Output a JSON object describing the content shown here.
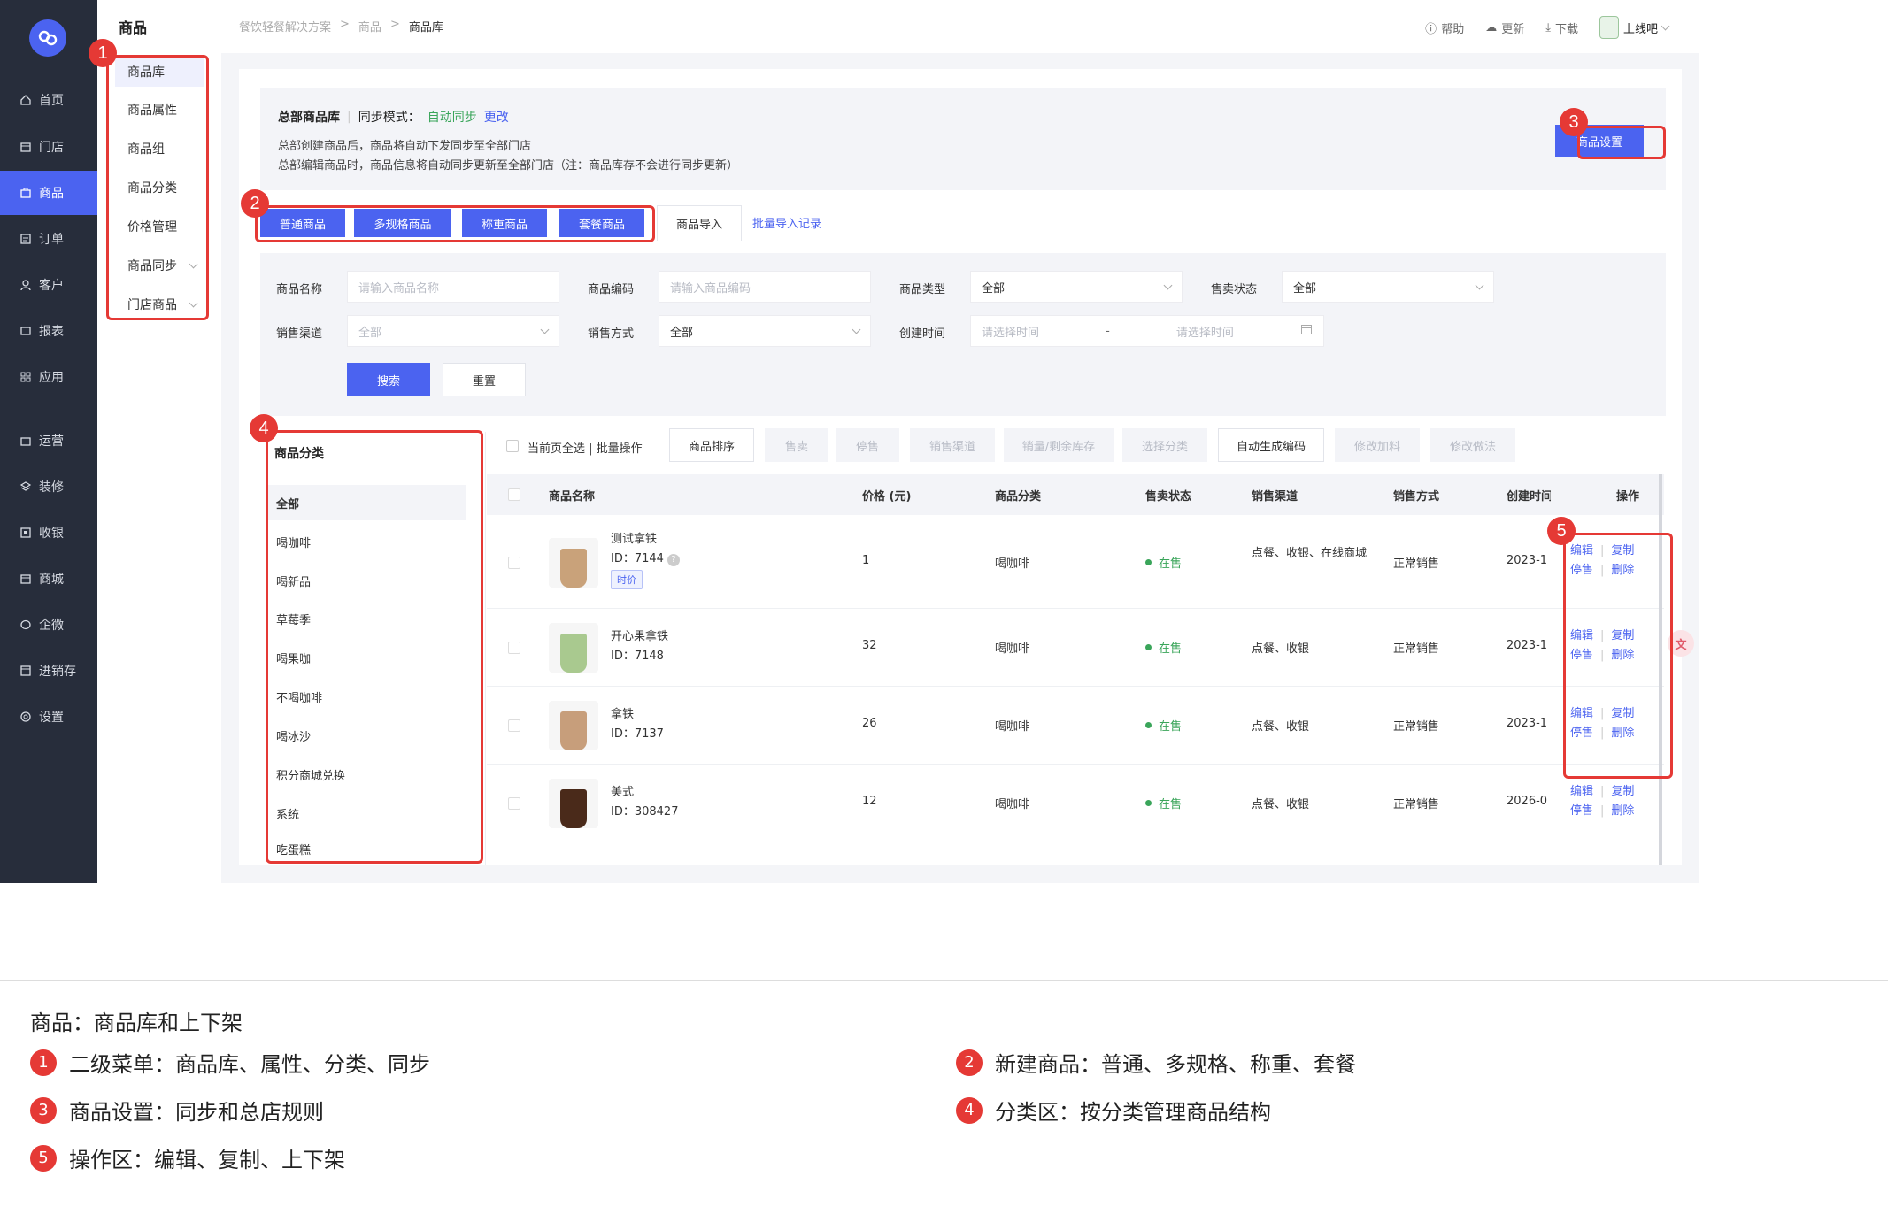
{
  "nav": {
    "items": [
      {
        "label": "首页",
        "icon": "home-icon"
      },
      {
        "label": "门店",
        "icon": "store-icon"
      },
      {
        "label": "商品",
        "icon": "goods-icon"
      },
      {
        "label": "订单",
        "icon": "order-icon"
      },
      {
        "label": "客户",
        "icon": "user-icon"
      },
      {
        "label": "报表",
        "icon": "report-icon"
      },
      {
        "label": "应用",
        "icon": "apps-icon"
      },
      {
        "label": "运营",
        "icon": "operation-icon"
      },
      {
        "label": "装修",
        "icon": "layers-icon"
      },
      {
        "label": "收银",
        "icon": "cashier-icon"
      },
      {
        "label": "商城",
        "icon": "mall-icon"
      },
      {
        "label": "企微",
        "icon": "chat-icon"
      },
      {
        "label": "进销存",
        "icon": "inventory-icon"
      },
      {
        "label": "设置",
        "icon": "settings-icon"
      }
    ]
  },
  "subnav": {
    "title": "商品",
    "items": [
      "商品库",
      "商品属性",
      "商品组",
      "商品分类",
      "价格管理",
      "商品同步",
      "门店商品"
    ]
  },
  "breadcrumb": [
    "餐饮轻餐解决方案",
    "商品",
    "商品库"
  ],
  "topbar": {
    "help": "帮助",
    "update": "更新",
    "download": "下载",
    "shop": "上线吧"
  },
  "info": {
    "title": "总部商品库",
    "sync_label": "同步模式：",
    "sync_value": "自动同步",
    "change": "更改",
    "desc1": "总部创建商品后，商品将自动下发同步至全部门店",
    "desc2": "总部编辑商品时，商品信息将自动同步更新至全部门店（注：商品库存不会进行同步更新）",
    "settings_btn": "商品设置"
  },
  "create_buttons": [
    "普通商品",
    "多规格商品",
    "称重商品",
    "套餐商品"
  ],
  "import": {
    "tab": "商品导入",
    "log": "批量导入记录"
  },
  "filters": {
    "name_label": "商品名称",
    "name_placeholder": "请输入商品名称",
    "code_label": "商品编码",
    "code_placeholder": "请输入商品编码",
    "type_label": "商品类型",
    "type_value": "全部",
    "sale_status_label": "售卖状态",
    "sale_status_value": "全部",
    "channel_label": "销售渠道",
    "channel_value": "全部",
    "method_label": "销售方式",
    "method_value": "全部",
    "time_label": "创建时间",
    "time_start_placeholder": "请选择时间",
    "time_sep": "-",
    "time_end_placeholder": "请选择时间",
    "search": "搜索",
    "reset": "重置"
  },
  "categories": {
    "title": "商品分类",
    "items": [
      "全部",
      "喝咖啡",
      "喝新品",
      "草莓季",
      "喝果咖",
      "不喝咖啡",
      "喝冰沙",
      "积分商城兑换",
      "系统",
      "吃蛋糕"
    ]
  },
  "toolbar": {
    "select_all": "当前页全选 | 批量操作",
    "buttons": [
      "商品排序",
      "售卖",
      "停售",
      "销售渠道",
      "销量/剩余库存",
      "选择分类",
      "自动生成编码",
      "修改加料",
      "修改做法"
    ]
  },
  "table": {
    "headers": [
      "商品名称",
      "价格 (元)",
      "商品分类",
      "售卖状态",
      "销售渠道",
      "销售方式",
      "创建时间",
      "操作"
    ],
    "rows": [
      {
        "name": "测试拿铁",
        "id": "ID：7144",
        "tag": "时价",
        "price": "1",
        "category": "喝咖啡",
        "status": "在售",
        "channel": "点餐、收银、在线商城",
        "method": "正常销售",
        "created": "2023-1",
        "cup": "#c9a27a"
      },
      {
        "name": "开心果拿铁",
        "id": "ID：7148",
        "price": "32",
        "category": "喝咖啡",
        "status": "在售",
        "channel": "点餐、收银",
        "method": "正常销售",
        "created": "2023-1",
        "cup": "#a9c98f"
      },
      {
        "name": "拿铁",
        "id": "ID：7137",
        "price": "26",
        "category": "喝咖啡",
        "status": "在售",
        "channel": "点餐、收银",
        "method": "正常销售",
        "created": "2023-1",
        "cup": "#c79e7b"
      },
      {
        "name": "美式",
        "id": "ID：308427",
        "price": "12",
        "category": "喝咖啡",
        "status": "在售",
        "channel": "点餐、收银",
        "method": "正常销售",
        "created": "2026-0",
        "cup": "#4a2a1a"
      }
    ],
    "ops": {
      "edit": "编辑",
      "copy": "复制",
      "stop": "停售",
      "delete": "删除"
    }
  },
  "annotations": {
    "caption": "商品：商品库和上下架",
    "items": [
      {
        "num": "1",
        "text": "二级菜单：商品库、属性、分类、同步"
      },
      {
        "num": "2",
        "text": "新建商品：普通、多规格、称重、套餐"
      },
      {
        "num": "3",
        "text": "商品设置：同步和总店规则"
      },
      {
        "num": "4",
        "text": "分类区：按分类管理商品结构"
      },
      {
        "num": "5",
        "text": "操作区：编辑、复制、上下架"
      }
    ]
  },
  "colors": {
    "primary": "#4b63f0",
    "nav_bg": "#272d3b",
    "annotation_red": "#e53935",
    "success": "#3aa55a"
  }
}
